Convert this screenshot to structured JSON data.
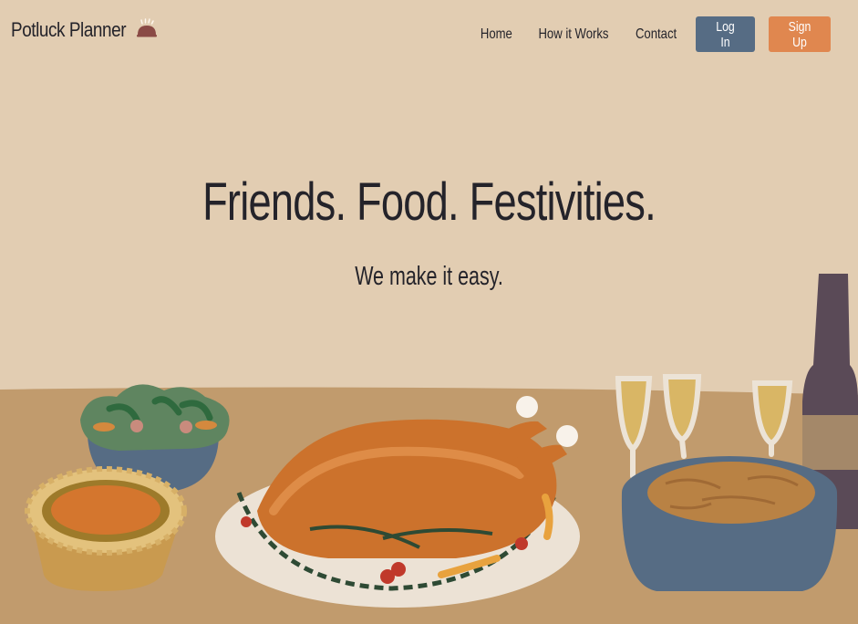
{
  "brand": {
    "name": "Potluck Planner",
    "icon": "dish-cloche-icon"
  },
  "nav": {
    "links": [
      "Home",
      "How it Works",
      "Contact"
    ],
    "login_label": "Log In",
    "signup_label": "Sign Up"
  },
  "hero": {
    "title": "Friends. Food. Festivities.",
    "subtitle": "We make it easy."
  },
  "colors": {
    "background": "#e2cdb2",
    "table": "#c19b6d",
    "login": "#566c84",
    "signup": "#e0874f",
    "text": "#24232a"
  }
}
